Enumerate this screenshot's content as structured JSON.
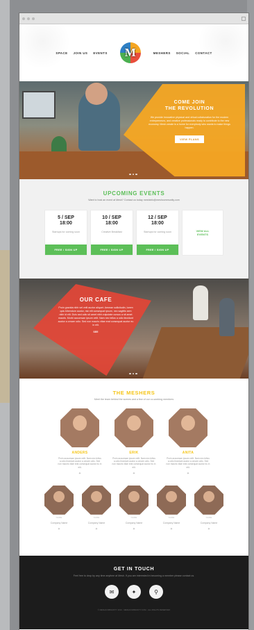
{
  "nav": {
    "left": [
      "SPACE",
      "JOIN US",
      "EVENTS"
    ],
    "logo_letter": "M",
    "right": [
      "MESHERS",
      "SOCIAL",
      "CONTACT"
    ]
  },
  "hero": {
    "title_line1": "COME JOIN",
    "title_line2": "THE REVOLUTION",
    "body": "We provide innovative physical and virtual collaboration for the modern entrepreneurs, and creative professionals ready to contribute to the new economy. Mesh.create is a home for everybody who wants to make things happen.",
    "button": "VIEW PLANS"
  },
  "events": {
    "title": "UPCOMING EVENTS",
    "subtitle": "Want to host an event at Mesh? Contact us today meshinfo@meshcommunity.com",
    "cards": [
      {
        "date": "5 / SEP",
        "time": "18:00",
        "desc": "Startups for\ncoming soon",
        "button": "FREE / SIGN UP"
      },
      {
        "date": "10 / SEP",
        "time": "18:00",
        "desc": "Creative Breakfast",
        "button": "FREE / SIGN UP"
      },
      {
        "date": "12 / SEP",
        "time": "18:00",
        "desc": "Startups for\ncoming soon",
        "button": "FREE / SIGN UP"
      }
    ],
    "view_all": "VIEW ALL EVENTS"
  },
  "cafe": {
    "title": "OUR CAFE",
    "body": "Proin gravida nibh vel velit auctor aliquet. Aenean sollicitudin, lorem quis bibendum auctor, nisi elit consequat ipsum, nec sagittis sem nibh id elit. Duis sed odio sit amet nibh vulputate cursus a sit amet mauris. Morbi accumsan ipsum velit. Nam nec tellus a odio tincidunt auctor a ornare odio. Sed non mauris vitae erat consequat auctor eu in elit.",
    "cta": "SEE"
  },
  "meshers": {
    "title": "THE MESHERS",
    "subtitle": "Meet the team behind the scenes and a few of our co-working members",
    "featured": [
      {
        "name": "ANDERS",
        "bio": "Proin accumsan ipsum velit. Nam nec tellus a odio tincidunt auctor a ornare odio. Sed non mauris vitae erat consequat auctor eu in elit."
      },
      {
        "name": "ERIK",
        "bio": "Proin accumsan ipsum velit. Nam nec tellus a odio tincidunt auctor a ornare odio. Sed non mauris vitae erat consequat auctor eu in elit."
      },
      {
        "name": "ANITA",
        "bio": "Proin accumsan ipsum velit. Nam nec tellus a odio tincidunt auctor a ornare odio. Sed non mauris vitae erat consequat auctor eu in elit."
      }
    ],
    "members": [
      {
        "label": "NAME",
        "company": "Company Name"
      },
      {
        "label": "NAME",
        "company": "Company Name"
      },
      {
        "label": "NAME",
        "company": "Company Name"
      },
      {
        "label": "NAME",
        "company": "Company Name"
      },
      {
        "label": "NAME",
        "company": "Company Name"
      }
    ]
  },
  "contact": {
    "title": "GET IN TOUCH",
    "subtitle": "Feel free to drop by any time anytime at Mesh. If you are interested in becoming a member please contact us.",
    "icons": [
      "mail-icon",
      "twitter-icon",
      "location-icon"
    ]
  },
  "footer": "© MESHCOMMUNITY 2013 · MESHCOMMUNITY.COM · ALL RIGHTS RESERVED",
  "colors": {
    "green": "#5cbf58",
    "orange": "#f5a623",
    "red": "#e04637",
    "yellow": "#f5c518",
    "dark": "#1c1c1c"
  }
}
